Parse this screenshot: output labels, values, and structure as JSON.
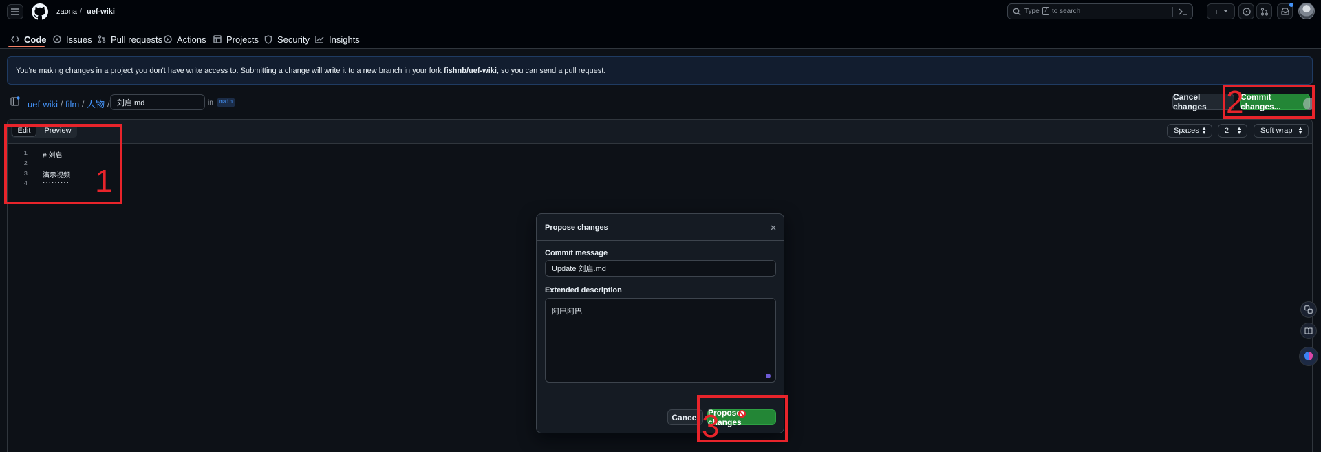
{
  "header": {
    "owner": "zaona",
    "separator": "/",
    "repo": "uef-wiki",
    "search_placeholder_type": "Type",
    "search_key": "/",
    "search_placeholder_rest": "to search",
    "plus_label": "+"
  },
  "tabs": [
    {
      "label": "Code",
      "icon": "code-icon"
    },
    {
      "label": "Issues",
      "icon": "issue-icon"
    },
    {
      "label": "Pull requests",
      "icon": "pull-request-icon"
    },
    {
      "label": "Actions",
      "icon": "actions-icon"
    },
    {
      "label": "Projects",
      "icon": "table-icon"
    },
    {
      "label": "Security",
      "icon": "shield-icon"
    },
    {
      "label": "Insights",
      "icon": "graph-icon"
    }
  ],
  "banner": {
    "text_before": "You're making changes in a project you don't have write access to. Submitting a change will write it to a new branch in your fork",
    "fork_name": "fishnb/uef-wiki",
    "text_after": ", so you can send a pull request."
  },
  "breadcrumb": {
    "repo": "uef-wiki",
    "sep": "/",
    "folder1": "film",
    "folder2": "人物",
    "filename": "刘启.md",
    "in_label": "in",
    "branch": "main"
  },
  "actions": {
    "cancel_label": "Cancel changes",
    "commit_label": "Commit changes..."
  },
  "editor": {
    "tab_edit": "Edit",
    "tab_preview": "Preview",
    "indent_mode": "Spaces",
    "indent_size": "2",
    "wrap_mode": "Soft wrap",
    "lines": [
      {
        "num": "1",
        "text": "# 刘启"
      },
      {
        "num": "2",
        "text": ""
      },
      {
        "num": "3",
        "text": "演示视频"
      },
      {
        "num": "4",
        "text": "·········"
      }
    ]
  },
  "dialog": {
    "title": "Propose changes",
    "commit_message_label": "Commit message",
    "commit_message_value": "Update 刘启.md",
    "extended_label": "Extended description",
    "extended_value": "阿巴阿巴",
    "cancel_label": "Cancel",
    "propose_label": "Propose changes"
  },
  "annotations": {
    "box1": "1",
    "box2": "2",
    "box3": "3"
  },
  "colors": {
    "background": "#0d1117",
    "header": "#010409",
    "link": "#4493f8",
    "primary": "#238636",
    "annotation": "#e8242b"
  }
}
